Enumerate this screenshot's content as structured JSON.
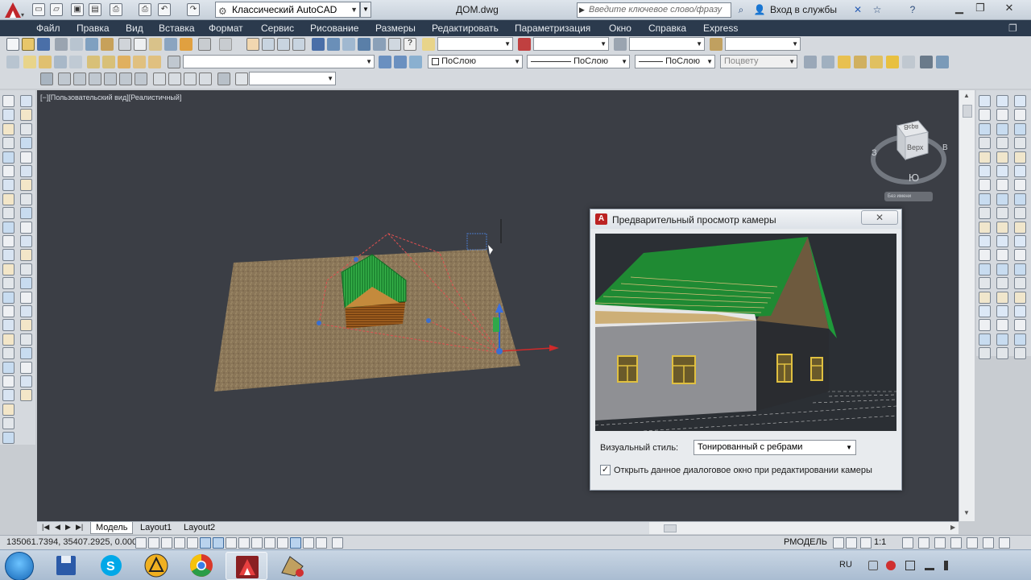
{
  "titlebar": {
    "workspace": "Классический AutoCAD",
    "document_title": "ДОМ.dwg",
    "search_placeholder": "Введите ключевое слово/фразу",
    "login": "Вход в службы"
  },
  "menu": [
    "Файл",
    "Правка",
    "Вид",
    "Вставка",
    "Формат",
    "Сервис",
    "Рисование",
    "Размеры",
    "Редактировать",
    "Параметризация",
    "Окно",
    "Справка",
    "Express"
  ],
  "properties": {
    "color": "ПоСлою",
    "linetype": "ПоСлою",
    "lineweight": "ПоСлою",
    "plotstyle": "Поцвету"
  },
  "viewport": {
    "label": "[−][Пользовательский вид][Реалистичный]",
    "viewcube_top": "Верх",
    "viewcube_south": "Ю",
    "viewcube_west": "З",
    "viewcube_east": "В",
    "ucs_label": "Без имени"
  },
  "tabs": [
    "Модель",
    "Layout1",
    "Layout2"
  ],
  "status": {
    "coords": "135061.7394, 35407.2925, 0.0000",
    "model": "РМОДЕЛЬ",
    "scale": "1:1"
  },
  "dialog": {
    "title": "Предварительный просмотр камеры",
    "visual_style_label": "Визуальный стиль:",
    "visual_style_value": "Тонированный с ребрами",
    "checkbox_label": "Открыть данное диалоговое окно при редактировании камеры",
    "checkbox_checked": true
  },
  "taskbar": {
    "language": "RU"
  },
  "colors": {
    "menubar": "#2b3a4d",
    "viewport_bg": "#3b3e45",
    "roof_green": "#1f9a3a",
    "accent_red": "#c0262b"
  }
}
